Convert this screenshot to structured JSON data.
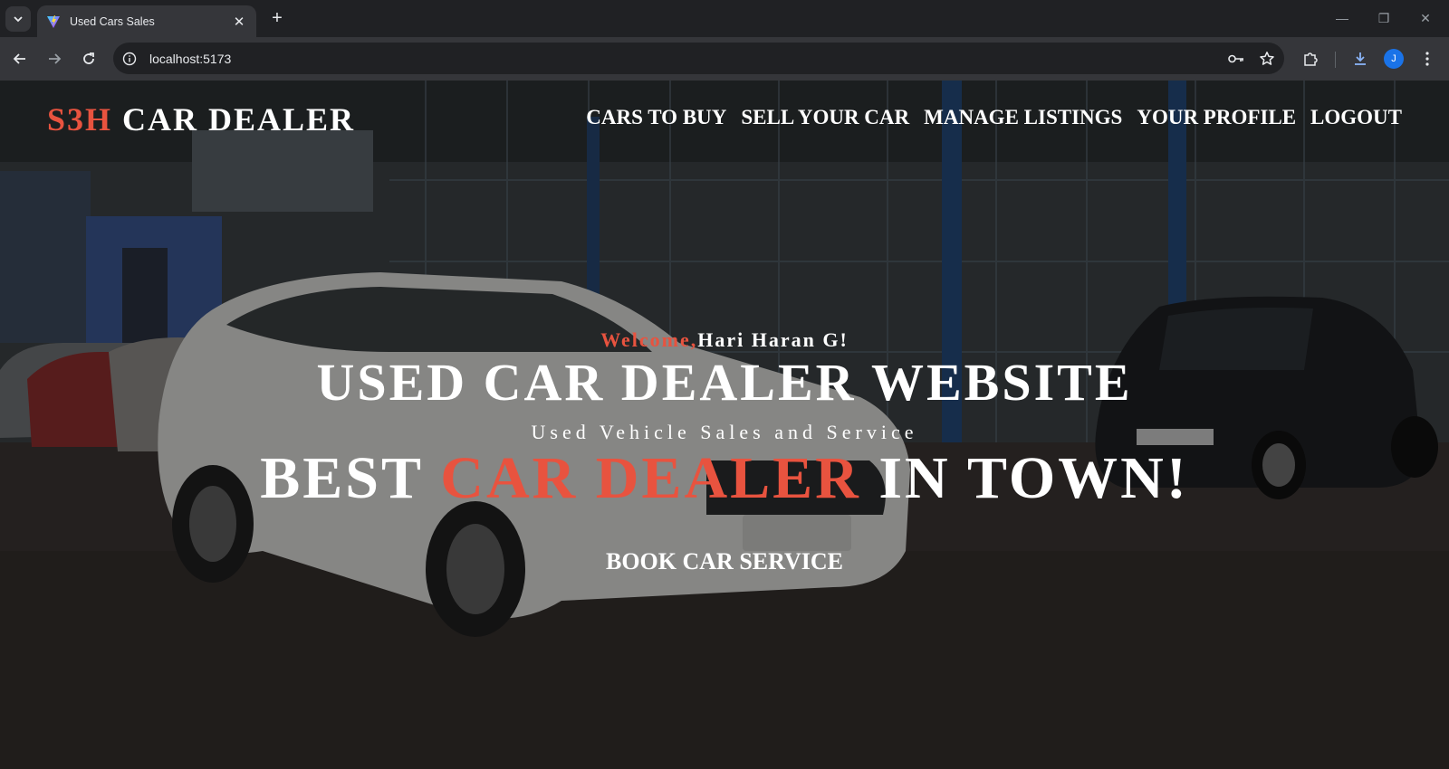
{
  "browser": {
    "tab_title": "Used Cars Sales",
    "url": "localhost:5173",
    "profile_initial": "J",
    "icons": {
      "tab_search": "chevron-down-icon",
      "close_tab": "close-icon",
      "new_tab": "plus-icon",
      "back": "arrow-left-icon",
      "forward": "arrow-right-icon",
      "reload": "reload-icon",
      "site_info": "info-icon",
      "passwords": "key-icon",
      "bookmark": "star-icon",
      "extensions": "puzzle-icon",
      "downloads": "download-icon",
      "menu": "kebab-menu-icon"
    }
  },
  "site": {
    "brand_accent": "S3H",
    "brand_rest": " CAR DEALER",
    "nav": [
      "CARS TO BUY",
      "SELL YOUR CAR",
      "MANAGE LISTINGS",
      "YOUR PROFILE",
      "LOGOUT"
    ],
    "accent_color": "#e8533f"
  },
  "hero": {
    "welcome_prefix": "Welcome,",
    "welcome_name": "Hari Haran G!",
    "title": "USED CAR DEALER WEBSITE",
    "subtitle": "Used Vehicle Sales and Service",
    "tagline_start": "BEST ",
    "tagline_accent": "CAR DEALER",
    "tagline_end": " IN TOWN!",
    "cta": "BOOK CAR SERVICE"
  }
}
